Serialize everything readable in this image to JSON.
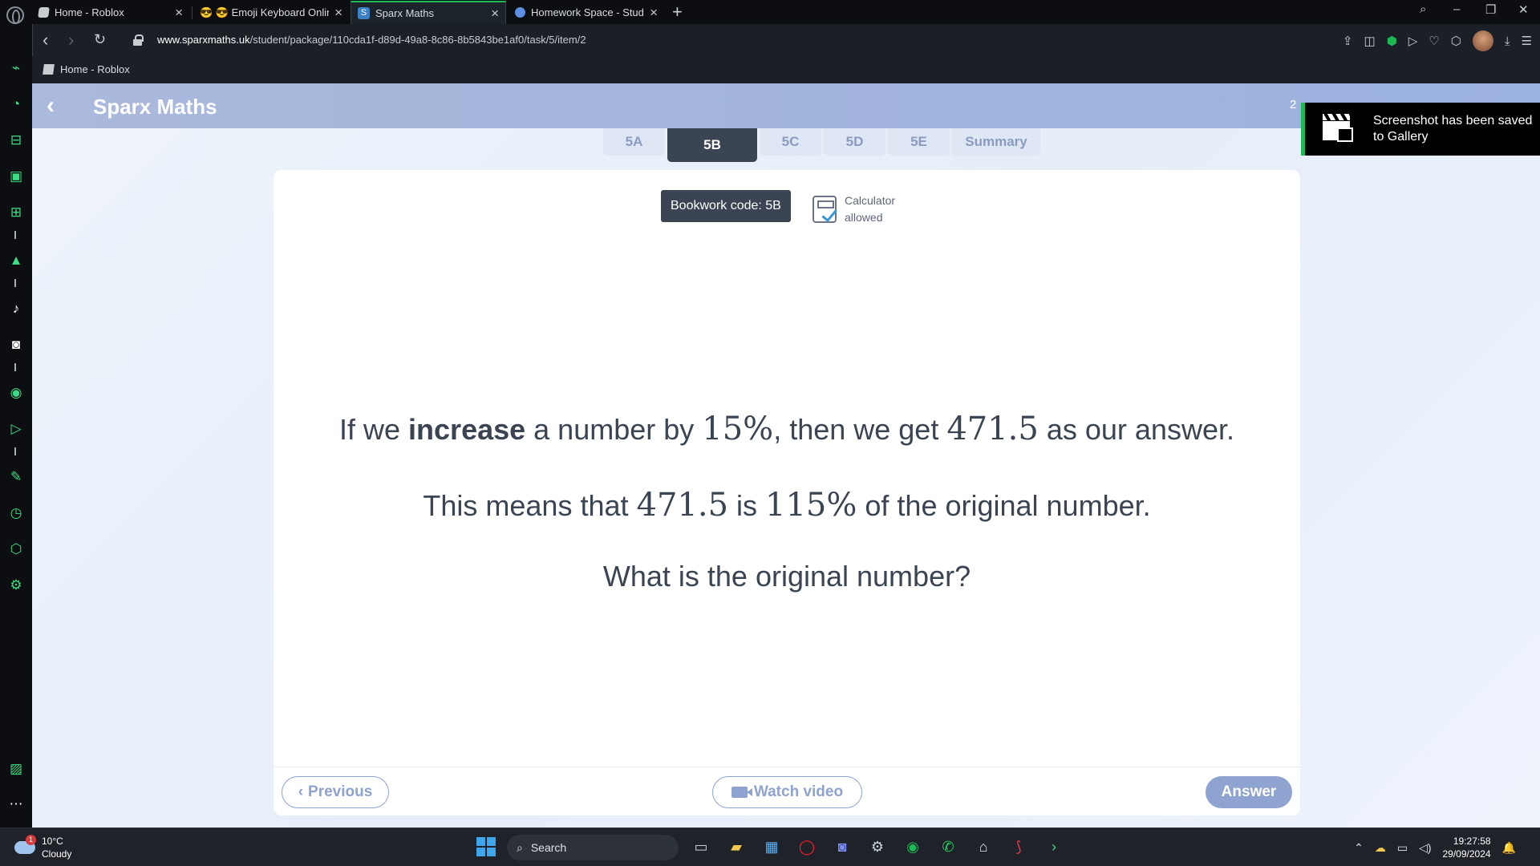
{
  "browser": {
    "tabs": [
      {
        "label": "Home - Roblox",
        "active": false
      },
      {
        "label": "😎 😎 Emoji Keyboard Online",
        "active": false
      },
      {
        "label": "Sparx Maths",
        "active": true
      },
      {
        "label": "Homework Space - StudyX",
        "active": false
      }
    ],
    "url_domain": "www.sparxmaths.uk",
    "url_path": "/student/package/110cda1f-d89d-49a8-8c86-8b5843be1af0/task/5/item/2",
    "bookmark": "Home - Roblox",
    "accent_color": "#1db954"
  },
  "sidebar": {
    "icons": [
      "gamepad-icon",
      "speed-dial-icon",
      "shopping-icon",
      "twitch-icon",
      "chip-icon",
      "aria-icon",
      "tiktok-icon",
      "discord-icon",
      "player-icon",
      "send-icon",
      "edit-icon",
      "history-icon",
      "box-icon",
      "settings-icon",
      "gallery-icon",
      "more-icon"
    ]
  },
  "app": {
    "name": "Sparx Maths",
    "header_number": "2",
    "tabs": [
      "5A",
      "5B",
      "5C",
      "5D",
      "5E",
      "Summary"
    ],
    "active_tab": "5B",
    "bookwork_code": "Bookwork code: 5B",
    "calculator_line1": "Calculator",
    "calculator_line2": "allowed",
    "question": {
      "l1_pre": "If we ",
      "l1_bold": "increase",
      "l1_mid": " a number by ",
      "l1_pct": "15%",
      "l1_mid2": ", then we get ",
      "l1_val": "471.5",
      "l1_post": " as our answer.",
      "l2_pre": "This means that ",
      "l2_val": "471.5",
      "l2_mid": " is ",
      "l2_pct": "115%",
      "l2_post": " of the original number.",
      "l3": "What is the original number?"
    },
    "buttons": {
      "previous": "Previous",
      "watch_video": "Watch video",
      "answer": "Answer"
    }
  },
  "toast": {
    "message": "Screenshot has been saved to Gallery"
  },
  "taskbar": {
    "temperature": "10°C",
    "weather": "Cloudy",
    "alert_count": "1",
    "search_placeholder": "Search",
    "time": "19:27:58",
    "date": "29/09/2024"
  }
}
